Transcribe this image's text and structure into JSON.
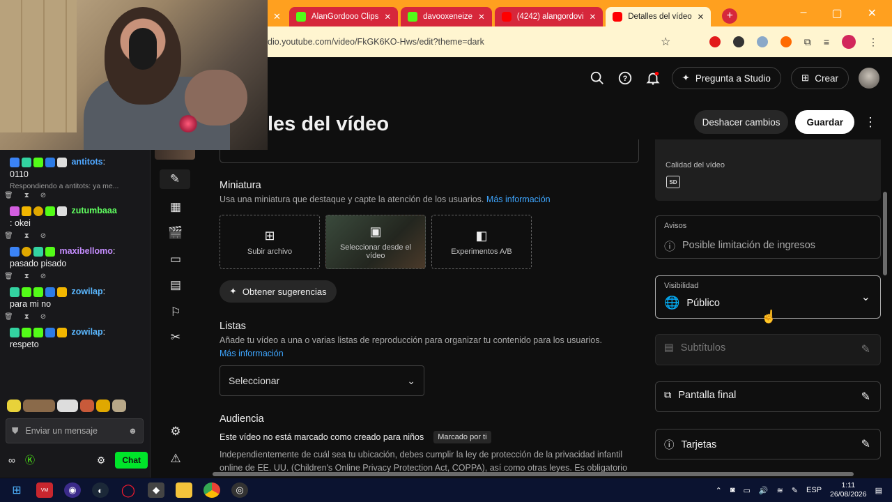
{
  "browser": {
    "tabs": [
      {
        "label": "AlanGordooo Clips",
        "kind": "kick"
      },
      {
        "label": "davooxeneize",
        "kind": "kick"
      },
      {
        "label": "(4242) alangordovi",
        "kind": "youtube"
      },
      {
        "label": "Detalles del vídeo",
        "kind": "studio",
        "active": true
      }
    ],
    "url": "dio.youtube.com/video/FkGK6KO-Hws/edit?theme=dark"
  },
  "studio": {
    "ask_label": "Pregunta a Studio",
    "create_label": "Crear",
    "page_title": "les del vídeo",
    "undo_label": "Deshacer cambios",
    "save_label": "Guardar"
  },
  "miniatura": {
    "title": "Miniatura",
    "desc": "Usa una miniatura que destaque y capte la atención de los usuarios.",
    "more": "Más información",
    "options": [
      "Subir archivo",
      "Seleccionar desde el vídeo",
      "Experimentos A/B"
    ],
    "suggest_label": "Obtener sugerencias"
  },
  "listas": {
    "title": "Listas",
    "desc": "Añade tu vídeo a una o varias listas de reproducción para organizar tu contenido para los usuarios.",
    "more": "Más información",
    "select_value": "Seleccionar"
  },
  "audiencia": {
    "title": "Audiencia",
    "status": "Este vídeo no está marcado como creado para niños",
    "tag": "Marcado por ti",
    "desc": "Independientemente de cuál sea tu ubicación, debes cumplir la ley de protección de la privacidad infantil online de EE. UU. (Children's Online Privacy Protection Act, COPPA), así como otras leyes. Es obligatorio"
  },
  "side": {
    "quality_label": "Calidad del vídeo",
    "quality_badge": "SD",
    "warnings_label": "Avisos",
    "warnings_value": "Posible limitación de ingresos",
    "visibility_label": "Visibilidad",
    "visibility_value": "Público",
    "subtitles": "Subtítulos",
    "endscreen": "Pantalla final",
    "cards": "Tarjetas"
  },
  "chat": {
    "messages": [
      {
        "user": "antitots",
        "text": "0110",
        "color": "#4fa7ff"
      },
      {
        "reply": "Respondiendo a antitots: ya me..."
      },
      {
        "user": "zutumbaaa",
        "text": ": okei",
        "color": "#60ff60"
      },
      {
        "user": "maxibellomo",
        "text": "pasado pisado",
        "color": "#c58dff"
      },
      {
        "user": "zowilap",
        "text": "para mi no",
        "color": "#5ab7ff"
      },
      {
        "user": "zowilap",
        "text": "respeto",
        "color": "#5ab7ff"
      }
    ],
    "input_placeholder": "Enviar un mensaje",
    "chat_button": "Chat"
  },
  "taskbar": {
    "lang": "ESP",
    "time": "1:11",
    "date": "26/08/2026"
  }
}
